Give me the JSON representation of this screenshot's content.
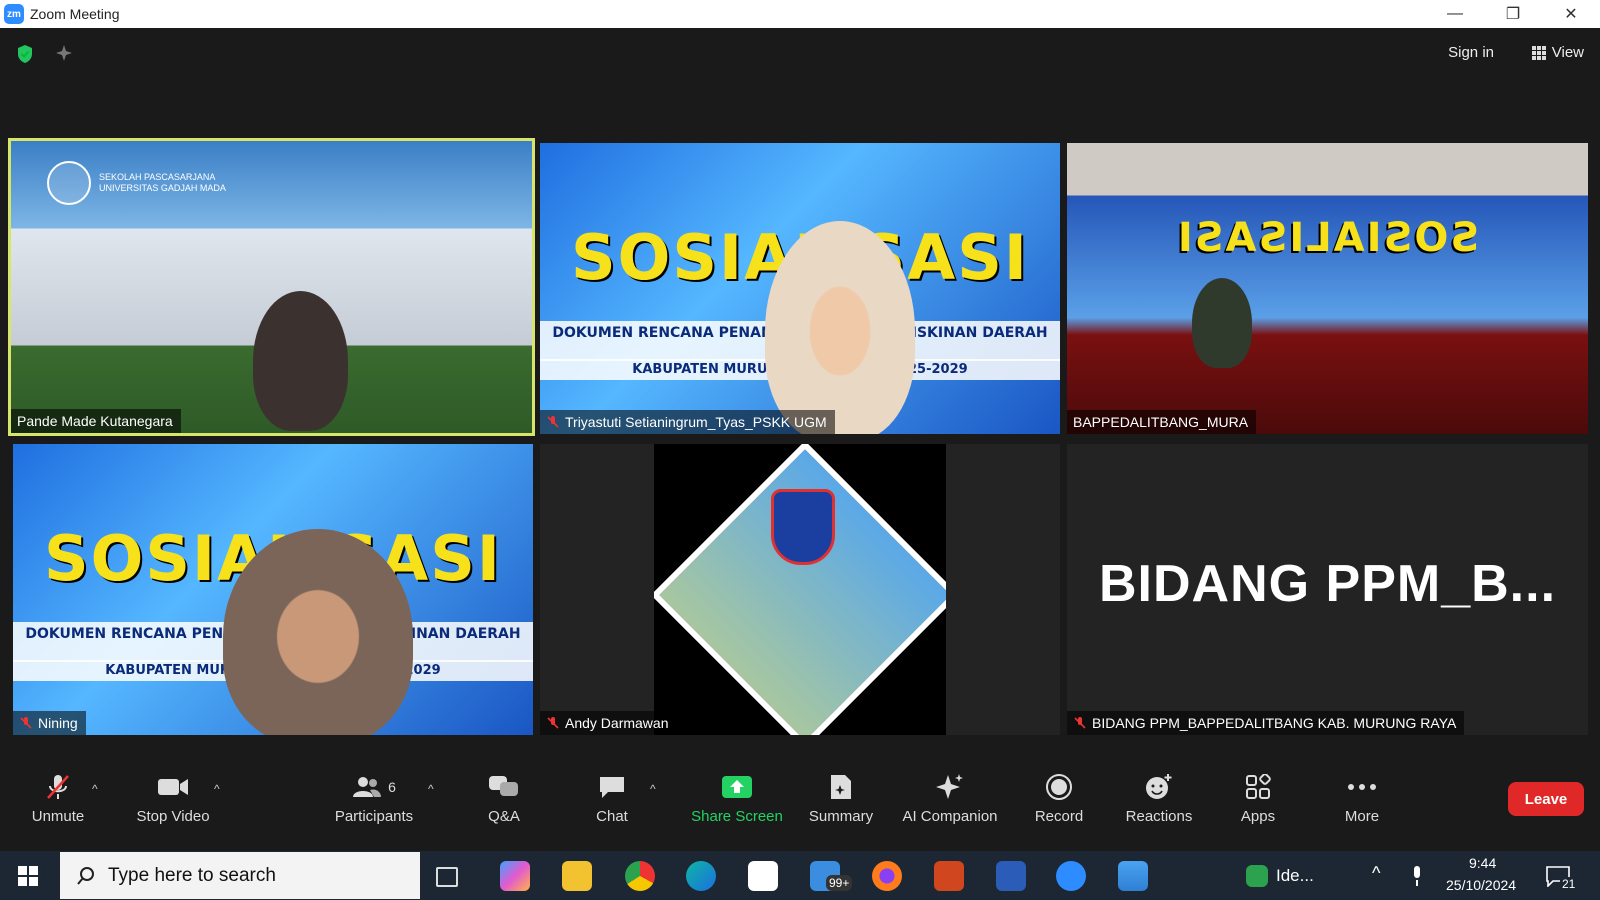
{
  "window": {
    "title": "Zoom Meeting",
    "logo_text": "zm",
    "minimize": "—",
    "restore": "❐",
    "close": "✕"
  },
  "topbar": {
    "signin": "Sign in",
    "view": "View"
  },
  "tiles": [
    {
      "name": "Pande Made Kutanegara",
      "header": "SEKOLAH PASCASARJANA\nUNIVERSITAS GADJAH MADA"
    },
    {
      "name": "Triyastuti Setianingrum_Tyas_PSKK UGM",
      "banner_word": "SOSIALISASI",
      "banner_sub": "DOKUMEN RENCANA PENANGGULANGAN KEMISKINAN DAERAH (RPKD)",
      "banner_sub2": "KABUPATEN MURUNG RAYA TAHUN 2025-2029"
    },
    {
      "name": "BAPPEDALITBANG_MURA",
      "banner_word": "SOSIALISASI"
    },
    {
      "name": "Nining",
      "banner_word": "SOSIALISASI",
      "banner_sub": "DOKUMEN RENCANA PENANGGULANGAN KEMISKINAN DAERAH (RPKD)",
      "banner_sub2": "KABUPATEN MURUNG RAYA TAHUN 2025-2029"
    },
    {
      "name": "Andy Darmawan"
    },
    {
      "name": "BIDANG PPM_BAPPEDALITBANG KAB. MURUNG RAYA",
      "big_label": "BIDANG  PPM_B..."
    }
  ],
  "toolbar": {
    "unmute": "Unmute",
    "stop_video": "Stop Video",
    "participants": "Participants",
    "participants_count": "6",
    "qa": "Q&A",
    "chat": "Chat",
    "share_screen": "Share Screen",
    "summary": "Summary",
    "ai_companion": "AI Companion",
    "record": "Record",
    "reactions": "Reactions",
    "apps": "Apps",
    "more": "More",
    "leave": "Leave"
  },
  "taskbar": {
    "search_placeholder": "Type here to search",
    "mail_badge": "99+",
    "ide_label": "Ide...",
    "time": "9:44",
    "date": "25/10/2024",
    "notification_count": "21"
  },
  "colors": {
    "accent": "#2D8CFF",
    "leave": "#e02828",
    "share": "#24d163",
    "active_border": "#d7e66b"
  }
}
